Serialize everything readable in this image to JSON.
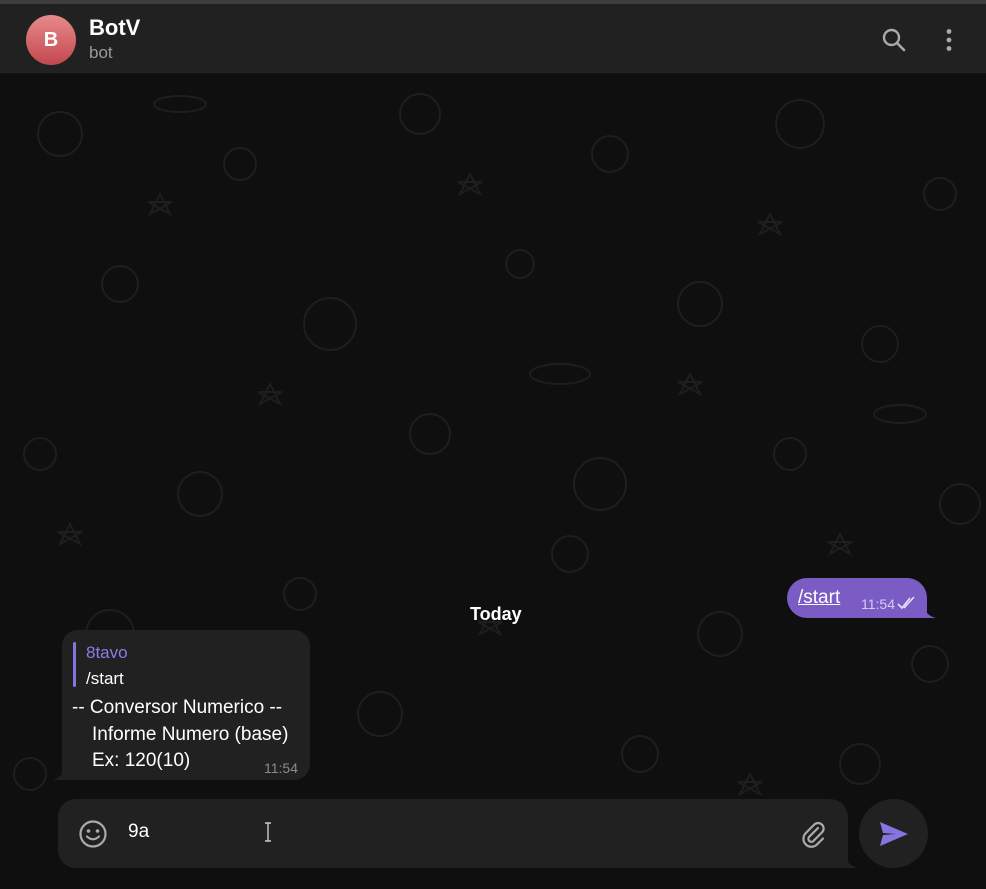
{
  "header": {
    "avatar_letter": "B",
    "title": "BotV",
    "subtitle": "bot",
    "search_icon": "search-icon",
    "more_icon": "more-vertical-icon"
  },
  "chat": {
    "date_separator": "Today",
    "outgoing": {
      "text": "/start",
      "time": "11:54",
      "status_icon": "double-check-icon"
    },
    "incoming": {
      "reply_to_name": "8tavo",
      "reply_to_text": "/start",
      "lines": [
        "-- Conversor Numerico --",
        "Informe Numero (base)",
        "Ex: 120(10)"
      ],
      "time": "11:54"
    }
  },
  "composer": {
    "value": "9a",
    "emoji_icon": "emoji-icon",
    "attach_icon": "paperclip-icon",
    "send_icon": "send-icon"
  },
  "colors": {
    "accent": "#8774e1",
    "outgoing_bubble": "#7b5cc4",
    "panel": "#212121",
    "background": "#0f0f0f"
  }
}
